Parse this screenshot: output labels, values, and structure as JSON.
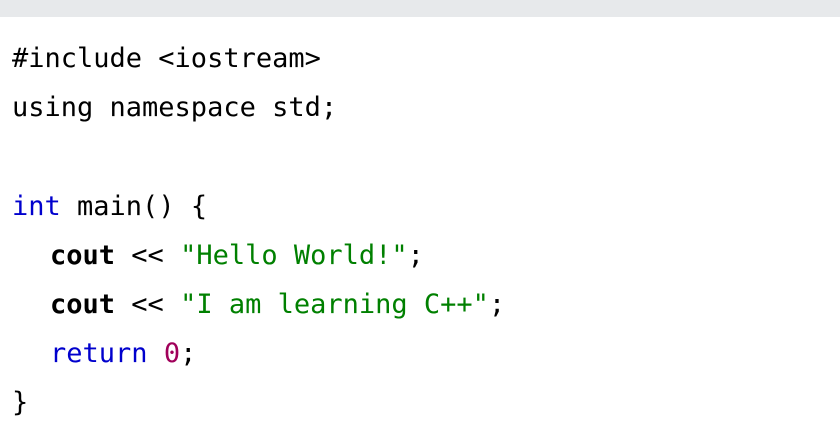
{
  "code": {
    "line1": "#include <iostream>",
    "line2": "using namespace std;",
    "line4_keyword": "int",
    "line4_rest": " main() {",
    "line5_cout": "cout",
    "line5_op": " << ",
    "line5_string": "\"Hello World!\"",
    "line5_end": ";",
    "line6_cout": "cout",
    "line6_op": " << ",
    "line6_string": "\"I am learning C++\"",
    "line6_end": ";",
    "line7_keyword": "return",
    "line7_space": " ",
    "line7_number": "0",
    "line7_end": ";",
    "line8": "}"
  },
  "colors": {
    "keyword": "#0000cd",
    "string": "#008000",
    "number": "#a0005a",
    "top_bar": "#e7e9eb"
  }
}
